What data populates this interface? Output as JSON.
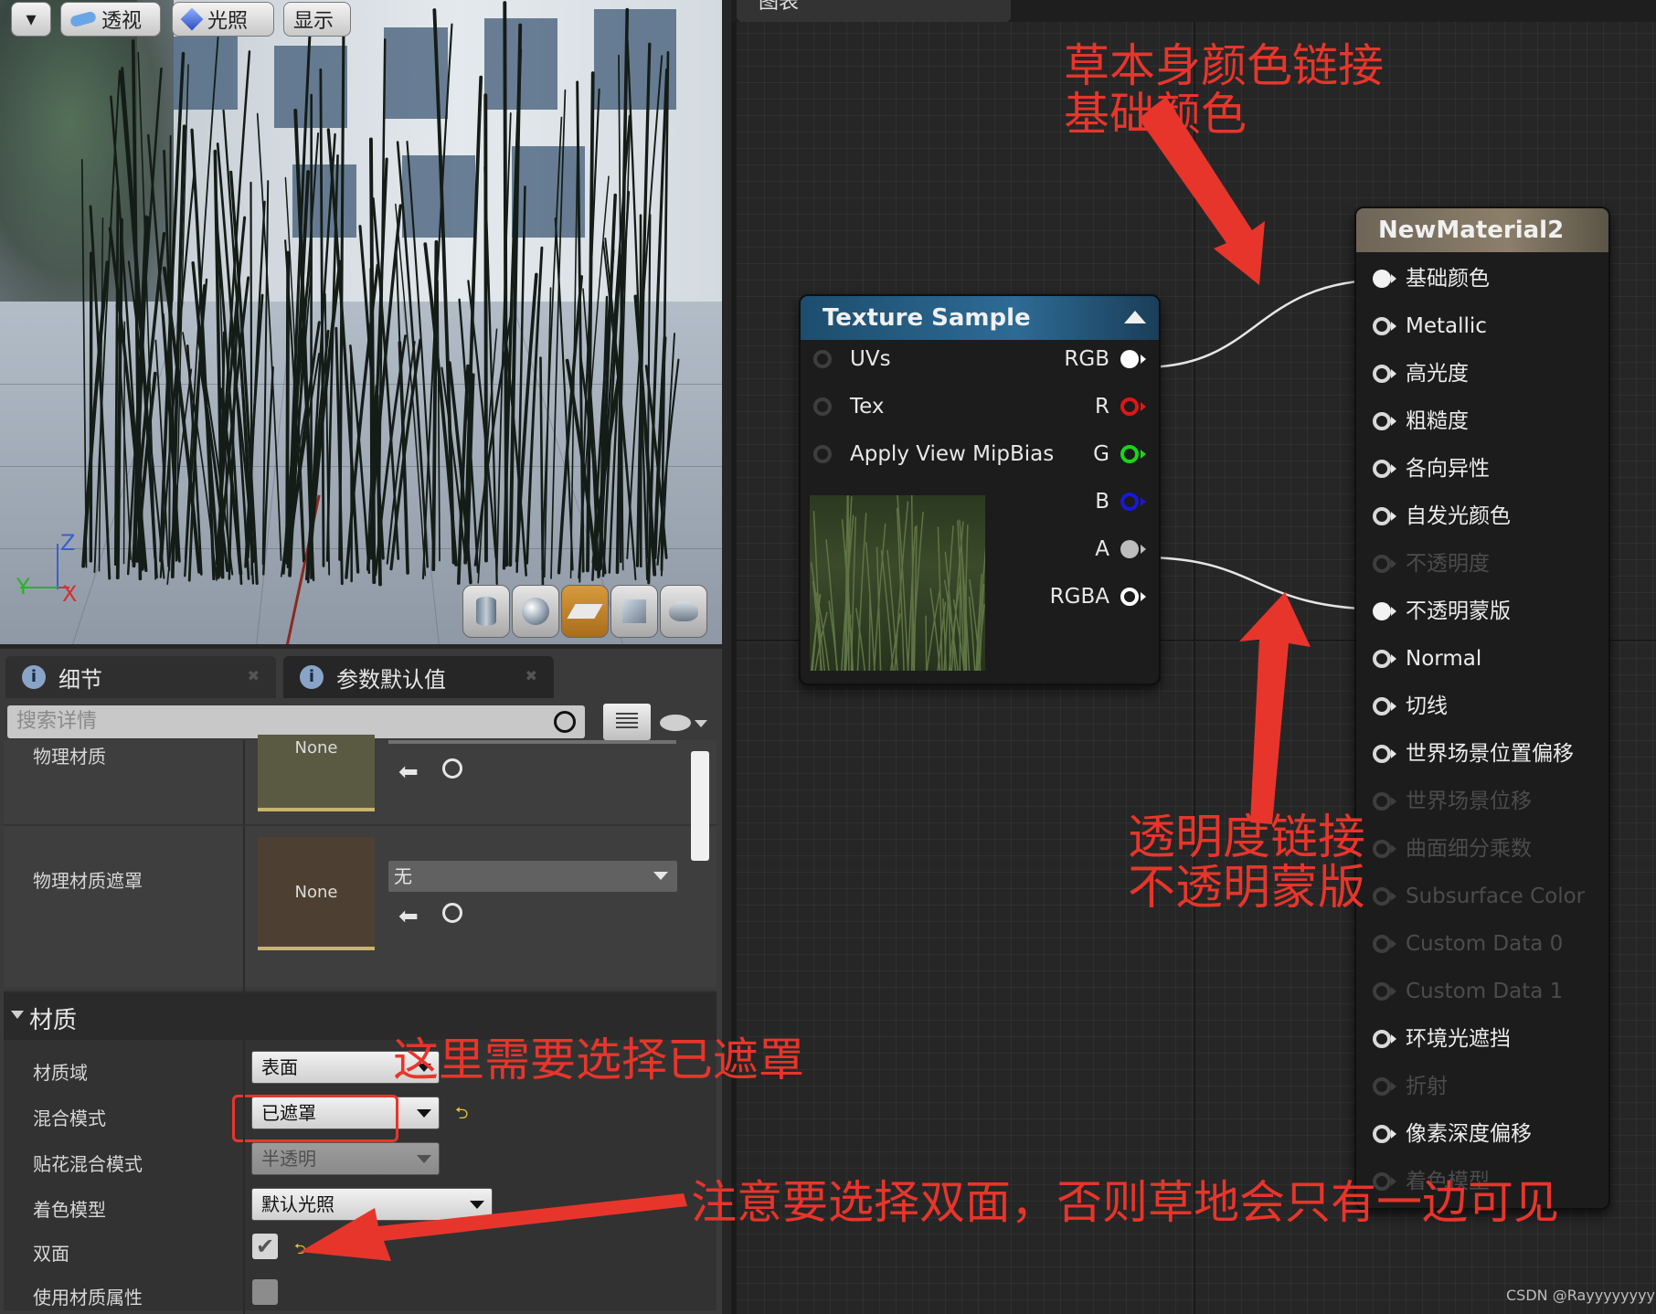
{
  "viewport": {
    "toolbar": {
      "dropdown_label": "▾",
      "perspective": "透视",
      "lighting": "光照",
      "show": "显示"
    },
    "axes": {
      "z": "Z",
      "y": "Y",
      "x": "X"
    },
    "preview_modes": [
      "cylinder",
      "sphere",
      "plane",
      "cube",
      "teapot"
    ],
    "active_mode_index": 2
  },
  "details_panel": {
    "tabs": [
      {
        "label": "细节",
        "icon": "info-icon"
      },
      {
        "label": "参数默认值",
        "icon": "info-icon"
      }
    ],
    "search_placeholder": "搜索详情",
    "physical_material": {
      "label": "物理材质",
      "thumb": "None"
    },
    "physical_material_mask": {
      "label": "物理材质遮罩",
      "thumb": "None",
      "value": "无"
    },
    "material_section": {
      "title": "材质",
      "rows": [
        {
          "label": "材质域",
          "value": "表面"
        },
        {
          "label": "混合模式",
          "value": "已遮罩"
        },
        {
          "label": "贴花混合模式",
          "value": "半透明"
        },
        {
          "label": "着色模型",
          "value": "默认光照"
        },
        {
          "label": "双面",
          "checked": true
        },
        {
          "label": "使用材质属性",
          "checked": false
        }
      ]
    }
  },
  "graph": {
    "tab_label": "图表",
    "texture_sample": {
      "title": "Texture Sample",
      "inputs": [
        "UVs",
        "Tex",
        "Apply View MipBias"
      ],
      "outputs": [
        {
          "label": "RGB",
          "color": "#ffffff",
          "connected": true
        },
        {
          "label": "R",
          "color": "#e01616",
          "connected": false
        },
        {
          "label": "G",
          "color": "#19d619",
          "connected": false
        },
        {
          "label": "B",
          "color": "#1818d8",
          "connected": false
        },
        {
          "label": "A",
          "color": "#bdbdbd",
          "connected": true
        },
        {
          "label": "RGBA",
          "color": "#ffffff",
          "connected": false
        }
      ]
    },
    "material_node": {
      "title": "NewMaterial2",
      "inputs": [
        {
          "label": "基础颜色",
          "state": "connected"
        },
        {
          "label": "Metallic",
          "state": "active"
        },
        {
          "label": "高光度",
          "state": "active"
        },
        {
          "label": "粗糙度",
          "state": "active"
        },
        {
          "label": "各向异性",
          "state": "active"
        },
        {
          "label": "自发光颜色",
          "state": "active"
        },
        {
          "label": "不透明度",
          "state": "disabled"
        },
        {
          "label": "不透明蒙版",
          "state": "connected"
        },
        {
          "label": "Normal",
          "state": "active"
        },
        {
          "label": "切线",
          "state": "active"
        },
        {
          "label": "世界场景位置偏移",
          "state": "active"
        },
        {
          "label": "世界场景位移",
          "state": "disabled"
        },
        {
          "label": "曲面细分乘数",
          "state": "disabled"
        },
        {
          "label": "Subsurface Color",
          "state": "disabled"
        },
        {
          "label": "Custom Data 0",
          "state": "disabled"
        },
        {
          "label": "Custom Data 1",
          "state": "disabled"
        },
        {
          "label": "环境光遮挡",
          "state": "active"
        },
        {
          "label": "折射",
          "state": "disabled"
        },
        {
          "label": "像素深度偏移",
          "state": "active"
        },
        {
          "label": "着色模型",
          "state": "disabled"
        }
      ]
    }
  },
  "annotations": {
    "base_color": [
      "草本身颜色链接",
      "基础颜色"
    ],
    "opacity": [
      "透明度链接",
      "不透明蒙版"
    ],
    "blend_mode": "这里需要选择已遮罩",
    "two_sided": "注意要选择双面，否则草地会只有一边可见",
    "color": "#e8352b"
  },
  "watermark": "CSDN @Rayyyyyyyy"
}
